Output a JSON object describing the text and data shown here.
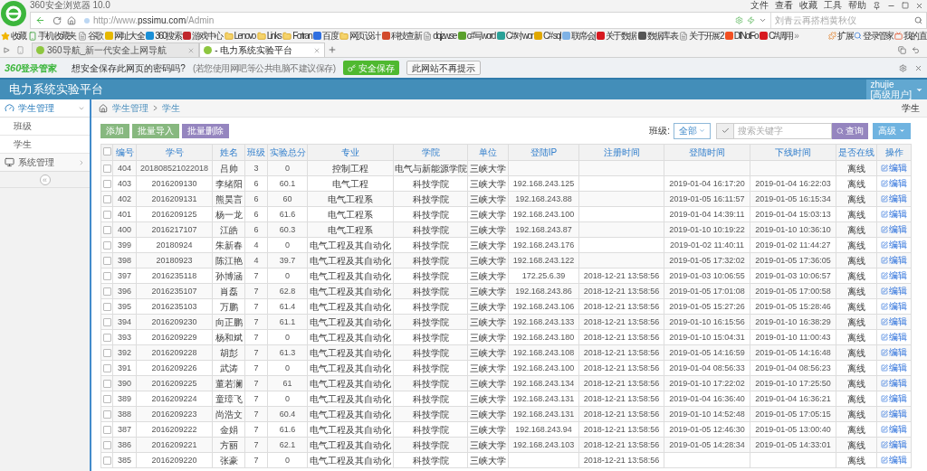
{
  "browser": {
    "title": "360安全浏览器 10.0",
    "menu": [
      "文件",
      "查看",
      "收藏",
      "工具",
      "帮助"
    ],
    "url": {
      "prefix": "http://www.",
      "host": "pssimu.com",
      "path": "/Admin"
    },
    "search_placeholder": "刘青云再搭档黄秋仪",
    "bookmarks": [
      {
        "label": "收藏",
        "kind": "star"
      },
      {
        "label": "手机收藏夹",
        "kind": "phone"
      },
      {
        "label": "谷歌",
        "kind": "page"
      },
      {
        "label": "网址大全",
        "kind": "site",
        "color": "#e6b800"
      },
      {
        "label": "360搜索",
        "kind": "site",
        "color": "#1a8fd6"
      },
      {
        "label": "游戏中心",
        "kind": "site",
        "color": "#c0282d"
      },
      {
        "label": "Lenovo",
        "kind": "folder"
      },
      {
        "label": "Links",
        "kind": "folder"
      },
      {
        "label": "Fortran",
        "kind": "folder"
      },
      {
        "label": "百度",
        "kind": "site",
        "color": "#2f6fe0"
      },
      {
        "label": "网页设计",
        "kind": "folder"
      },
      {
        "label": "科技查新",
        "kind": "site",
        "color": "#d24a2c"
      },
      {
        "label": "dqjzw.se",
        "kind": "page"
      },
      {
        "label": "c#写word",
        "kind": "site",
        "color": "#5aa02c"
      },
      {
        "label": "C#对wor",
        "kind": "site",
        "color": "#2aa198"
      },
      {
        "label": "C# sql",
        "kind": "site",
        "color": "#e0a800"
      },
      {
        "label": "联席会|",
        "kind": "site",
        "color": "#7fb2e5"
      },
      {
        "label": "关于数据",
        "kind": "site",
        "color": "#d71920"
      },
      {
        "label": "数据库表",
        "kind": "site",
        "color": "#555555"
      },
      {
        "label": "关于开展2",
        "kind": "page"
      },
      {
        "label": "DllNotFo",
        "kind": "site",
        "color": "#f25022"
      },
      {
        "label": "C#调用",
        "kind": "site",
        "color": "#d71920"
      }
    ],
    "overflow": "»",
    "right_items": [
      "扩展",
      "登录管家",
      "我的直"
    ],
    "tabs": [
      {
        "label": "360导航_新一代安全上网导航",
        "selected": false
      },
      {
        "label": "- 电力系统实验平台",
        "selected": true
      }
    ],
    "password_bar": {
      "brand": "360",
      "brand_suffix": "登录管家",
      "question": "想安全保存此网页的密码吗?",
      "note": "(若您使用网吧等公共电脑不建议保存)",
      "save": "安全保存",
      "dismiss": "此网站不再提示"
    }
  },
  "app": {
    "title": "电力系统实验平台",
    "user": "zhujie",
    "role": "[高级用户]"
  },
  "sidebar": {
    "items": [
      {
        "label": "学生管理",
        "kind": "gauge",
        "expanded": true,
        "children": [
          {
            "label": "班级"
          },
          {
            "label": "学生"
          }
        ]
      },
      {
        "label": "系统管理",
        "kind": "monitor",
        "expanded": false
      }
    ],
    "collapse": "«"
  },
  "breadcrumb": [
    "学生管理",
    "学生"
  ],
  "page_label": "学生",
  "toolbar": {
    "buttons": [
      {
        "label": "添加",
        "kind": "success"
      },
      {
        "label": "批量导入",
        "kind": "success"
      },
      {
        "label": "批量删除",
        "kind": "purple"
      }
    ],
    "filter_label": "班级:",
    "filter_value": "全部",
    "search_placeholder": "搜索关键字",
    "search_button": "查询",
    "advanced": "高级"
  },
  "table": {
    "header_checked": false,
    "columns": [
      "编号",
      "学号",
      "姓名",
      "班级",
      "实验总分",
      "专业",
      "学院",
      "单位",
      "登陆IP",
      "注册时间",
      "登陆时间",
      "下线时间",
      "是否在线",
      "操作"
    ],
    "rows": [
      {
        "checked": false,
        "id": "404",
        "student_no": "201808521022018",
        "name": "吕帅",
        "class": "3",
        "score": "0",
        "major": "控制工程",
        "college": "电气与新能源学院",
        "unit": "三峡大学",
        "online": "离线",
        "action": "编辑"
      },
      {
        "checked": false,
        "id": "403",
        "student_no": "2016209130",
        "name": "李绪阳",
        "class": "6",
        "score": "60.1",
        "major": "电气工程",
        "college": "科技学院",
        "unit": "三峡大学",
        "ip": "192.168.243.125",
        "login": "2019-01-04 16:17:20",
        "logout": "2019-01-04 16:22:03",
        "online": "离线",
        "action": "编辑"
      },
      {
        "checked": false,
        "id": "402",
        "student_no": "2016209131",
        "name": "熊昊言",
        "class": "6",
        "score": "60",
        "major": "电气工程系",
        "college": "科技学院",
        "unit": "三峡大学",
        "ip": "192.168.243.88",
        "login": "2019-01-05 16:11:57",
        "logout": "2019-01-05 16:15:34",
        "online": "离线",
        "action": "编辑"
      },
      {
        "checked": false,
        "id": "401",
        "student_no": "2016209125",
        "name": "杨一龙",
        "class": "6",
        "score": "61.6",
        "major": "电气工程系",
        "college": "科技学院",
        "unit": "三峡大学",
        "ip": "192.168.243.100",
        "login": "2019-01-04 14:39:11",
        "logout": "2019-01-04 15:03:13",
        "online": "离线",
        "action": "编辑"
      },
      {
        "checked": false,
        "id": "400",
        "student_no": "2016217107",
        "name": "江皓",
        "class": "6",
        "score": "60.3",
        "major": "电气工程系",
        "college": "科技学院",
        "unit": "三峡大学",
        "ip": "192.168.243.87",
        "login": "2019-01-10 10:19:22",
        "logout": "2019-01-10 10:36:10",
        "online": "离线",
        "action": "编辑"
      },
      {
        "checked": false,
        "id": "399",
        "student_no": "20180924",
        "name": "朱新春",
        "class": "4",
        "score": "0",
        "major": "电气工程及其自动化",
        "college": "科技学院",
        "unit": "三峡大学",
        "ip": "192.168.243.176",
        "login": "2019-01-02 11:40:11",
        "logout": "2019-01-02 11:44:27",
        "online": "离线",
        "action": "编辑"
      },
      {
        "checked": false,
        "id": "398",
        "student_no": "20180923",
        "name": "陈江艳",
        "class": "4",
        "score": "39.7",
        "major": "电气工程及其自动化",
        "college": "科技学院",
        "unit": "三峡大学",
        "ip": "192.168.243.122",
        "login": "2019-01-05 17:32:02",
        "logout": "2019-01-05 17:36:05",
        "online": "离线",
        "action": "编辑"
      },
      {
        "checked": false,
        "id": "397",
        "student_no": "2016235118",
        "name": "孙博涵",
        "class": "7",
        "score": "0",
        "major": "电气工程及其自动化",
        "college": "科技学院",
        "unit": "三峡大学",
        "ip": "172.25.6.39",
        "registered": "2018-12-21 13:58:56",
        "login": "2019-01-03 10:06:55",
        "logout": "2019-01-03 10:06:57",
        "online": "离线",
        "action": "编辑"
      },
      {
        "checked": false,
        "id": "396",
        "student_no": "2016235107",
        "name": "肖磊",
        "class": "7",
        "score": "62.8",
        "major": "电气工程及其自动化",
        "college": "科技学院",
        "unit": "三峡大学",
        "ip": "192.168.243.86",
        "registered": "2018-12-21 13:58:56",
        "login": "2019-01-05 17:01:08",
        "logout": "2019-01-05 17:00:58",
        "online": "离线",
        "action": "编辑"
      },
      {
        "checked": false,
        "id": "395",
        "student_no": "2016235103",
        "name": "万鹏",
        "class": "7",
        "score": "61.4",
        "major": "电气工程及其自动化",
        "college": "科技学院",
        "unit": "三峡大学",
        "ip": "192.168.243.106",
        "registered": "2018-12-21 13:58:56",
        "login": "2019-01-05 15:27:26",
        "logout": "2019-01-05 15:28:46",
        "online": "离线",
        "action": "编辑"
      },
      {
        "checked": false,
        "id": "394",
        "student_no": "2016209230",
        "name": "向正鹏",
        "class": "7",
        "score": "61.1",
        "major": "电气工程及其自动化",
        "college": "科技学院",
        "unit": "三峡大学",
        "ip": "192.168.243.133",
        "registered": "2018-12-21 13:58:56",
        "login": "2019-01-10 16:15:56",
        "logout": "2019-01-10 16:38:29",
        "online": "离线",
        "action": "编辑"
      },
      {
        "checked": false,
        "id": "393",
        "student_no": "2016209229",
        "name": "杨和斌",
        "class": "7",
        "score": "0",
        "major": "电气工程及其自动化",
        "college": "科技学院",
        "unit": "三峡大学",
        "ip": "192.168.243.180",
        "registered": "2018-12-21 13:58:56",
        "login": "2019-01-10 15:04:31",
        "logout": "2019-01-10 11:00:43",
        "online": "离线",
        "action": "编辑"
      },
      {
        "checked": false,
        "id": "392",
        "student_no": "2016209228",
        "name": "胡彭",
        "class": "7",
        "score": "61.3",
        "major": "电气工程及其自动化",
        "college": "科技学院",
        "unit": "三峡大学",
        "ip": "192.168.243.108",
        "registered": "2018-12-21 13:58:56",
        "login": "2019-01-05 14:16:59",
        "logout": "2019-01-05 14:16:48",
        "online": "离线",
        "action": "编辑"
      },
      {
        "checked": false,
        "id": "391",
        "student_no": "2016209226",
        "name": "武涛",
        "class": "7",
        "score": "0",
        "major": "电气工程及其自动化",
        "college": "科技学院",
        "unit": "三峡大学",
        "ip": "192.168.243.100",
        "registered": "2018-12-21 13:58:56",
        "login": "2019-01-04 08:56:33",
        "logout": "2019-01-04 08:56:23",
        "online": "离线",
        "action": "编辑"
      },
      {
        "checked": false,
        "id": "390",
        "student_no": "2016209225",
        "name": "董若澜",
        "class": "7",
        "score": "61",
        "major": "电气工程及其自动化",
        "college": "科技学院",
        "unit": "三峡大学",
        "ip": "192.168.243.134",
        "registered": "2018-12-21 13:58:56",
        "login": "2019-01-10 17:22:02",
        "logout": "2019-01-10 17:25:50",
        "online": "离线",
        "action": "编辑"
      },
      {
        "checked": false,
        "id": "389",
        "student_no": "2016209224",
        "name": "童璋飞",
        "class": "7",
        "score": "0",
        "major": "电气工程及其自动化",
        "college": "科技学院",
        "unit": "三峡大学",
        "ip": "192.168.243.131",
        "registered": "2018-12-21 13:58:56",
        "login": "2019-01-04 16:36:40",
        "logout": "2019-01-04 16:36:21",
        "online": "离线",
        "action": "编辑"
      },
      {
        "checked": false,
        "id": "388",
        "student_no": "2016209223",
        "name": "尚浩文",
        "class": "7",
        "score": "60.4",
        "major": "电气工程及其自动化",
        "college": "科技学院",
        "unit": "三峡大学",
        "ip": "192.168.243.131",
        "registered": "2018-12-21 13:58:56",
        "login": "2019-01-10 14:52:48",
        "logout": "2019-01-05 17:05:15",
        "online": "离线",
        "action": "编辑"
      },
      {
        "checked": false,
        "id": "387",
        "student_no": "2016209222",
        "name": "金娟",
        "class": "7",
        "score": "61.6",
        "major": "电气工程及其自动化",
        "college": "科技学院",
        "unit": "三峡大学",
        "ip": "192.168.243.94",
        "registered": "2018-12-21 13:58:56",
        "login": "2019-01-05 12:46:30",
        "logout": "2019-01-05 13:00:40",
        "online": "离线",
        "action": "编辑"
      },
      {
        "checked": false,
        "id": "386",
        "student_no": "2016209221",
        "name": "方丽",
        "class": "7",
        "score": "62.1",
        "major": "电气工程及其自动化",
        "college": "科技学院",
        "unit": "三峡大学",
        "ip": "192.168.243.103",
        "registered": "2018-12-21 13:58:56",
        "login": "2019-01-05 14:28:34",
        "logout": "2019-01-05 14:33:01",
        "online": "离线",
        "action": "编辑"
      },
      {
        "checked": false,
        "id": "385",
        "student_no": "2016209220",
        "name": "张豪",
        "class": "7",
        "score": "0",
        "major": "电气工程及其自动化",
        "college": "科技学院",
        "unit": "三峡大学",
        "registered": "2018-12-21 13:58:56",
        "online": "离线",
        "action": "编辑"
      }
    ]
  }
}
